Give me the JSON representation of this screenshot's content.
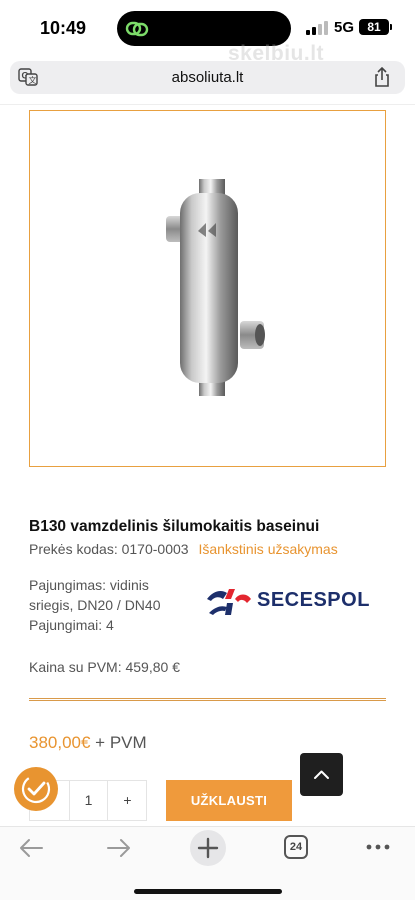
{
  "status_bar": {
    "time": "10:49",
    "network": "5G",
    "battery": "81"
  },
  "watermark": "skelbiu.lt",
  "browser": {
    "url": "absoliuta.lt",
    "tab_count": "24"
  },
  "product": {
    "title": "B130 vamzdelinis šilumokaitis baseinui",
    "sku_label": "Prekės kodas: 0170-0003",
    "availability": "Išankstinis užsakymas",
    "spec_line1": "Pajungimas: vidinis",
    "spec_line2": "sriegis, DN20 / DN40",
    "spec_line3": "Pajungimai: 4",
    "brand": "SECESPOL",
    "price_with_vat": "Kaina su PVM: 459,80 €",
    "price_amount": "380,00€",
    "price_suffix": " + PVM"
  },
  "cart": {
    "minus": "-",
    "quantity": "1",
    "plus": "+",
    "inquire_label": "UŽKLAUSTI"
  },
  "colors": {
    "accent": "#e89430",
    "brand_blue": "#1d2f6b",
    "brand_red": "#e3262f"
  }
}
